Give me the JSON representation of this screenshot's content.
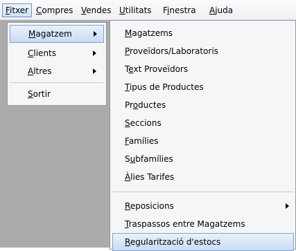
{
  "menubar": {
    "items": [
      {
        "pre": "",
        "u": "F",
        "post": "itxer"
      },
      {
        "pre": "",
        "u": "C",
        "post": "ompres"
      },
      {
        "pre": "",
        "u": "V",
        "post": "endes"
      },
      {
        "pre": "",
        "u": "U",
        "post": "tilitats"
      },
      {
        "pre": "F",
        "u": "i",
        "post": "nestra"
      },
      {
        "pre": "",
        "u": "A",
        "post": "juda"
      }
    ]
  },
  "fitxer_menu": {
    "items": [
      {
        "pre": "",
        "u": "M",
        "post": "agatzem"
      },
      {
        "pre": "",
        "u": "C",
        "post": "lients"
      },
      {
        "pre": "",
        "u": "A",
        "post": "ltres"
      },
      {
        "pre": "",
        "u": "S",
        "post": "ortir"
      }
    ]
  },
  "magatzem_menu": {
    "items": [
      {
        "pre": "",
        "u": "M",
        "post": "agatzems"
      },
      {
        "pre": "",
        "u": "P",
        "post": "roveïdors/Laboratoris"
      },
      {
        "pre": "T",
        "u": "e",
        "post": "xt Proveïdors"
      },
      {
        "pre": "",
        "u": "T",
        "post": "ipus de Productes"
      },
      {
        "pre": "Pr",
        "u": "o",
        "post": "ductes"
      },
      {
        "pre": "",
        "u": "S",
        "post": "eccions"
      },
      {
        "pre": "",
        "u": "F",
        "post": "amílies"
      },
      {
        "pre": "S",
        "u": "u",
        "post": "bfamílies"
      },
      {
        "pre": "",
        "u": "À",
        "post": "lies Tarifes"
      },
      {
        "pre": "",
        "u": "R",
        "post": "eposicions"
      },
      {
        "pre": "",
        "u": "T",
        "post": "raspassos entre Magatzems"
      },
      {
        "pre": "",
        "u": "R",
        "post": "egularització d'estocs"
      }
    ]
  }
}
